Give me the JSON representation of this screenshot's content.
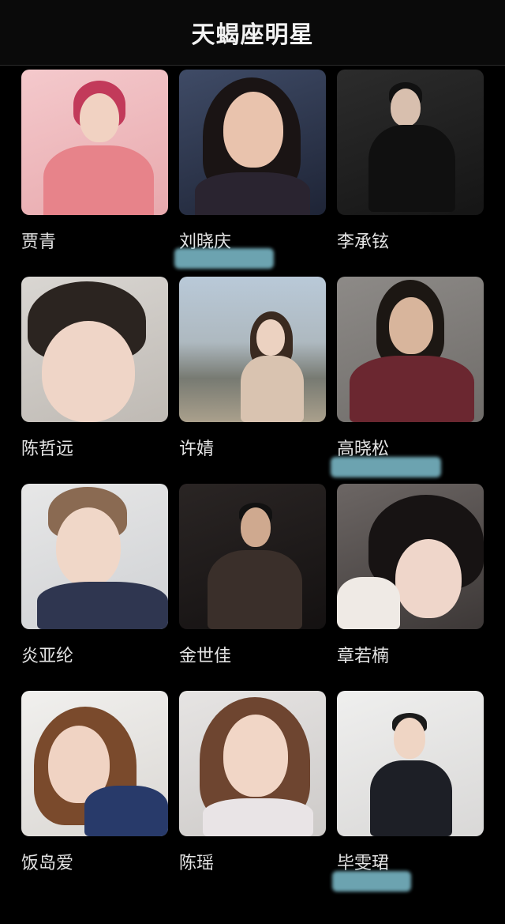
{
  "header": {
    "title": "天蝎座明星"
  },
  "celebrities": [
    {
      "name": "贾青"
    },
    {
      "name": "刘晓庆"
    },
    {
      "name": "李承铉"
    },
    {
      "name": "陈哲远"
    },
    {
      "name": "许婧"
    },
    {
      "name": "高晓松"
    },
    {
      "name": "炎亚纶"
    },
    {
      "name": "金世佳"
    },
    {
      "name": "章若楠"
    },
    {
      "name": "饭岛爱"
    },
    {
      "name": "陈瑶"
    },
    {
      "name": "毕雯珺"
    }
  ],
  "colors": {
    "background": "#000000",
    "header_bg": "#0a0a0a",
    "name_text": "#e4e4e4",
    "redaction": "#7fc0cf"
  }
}
